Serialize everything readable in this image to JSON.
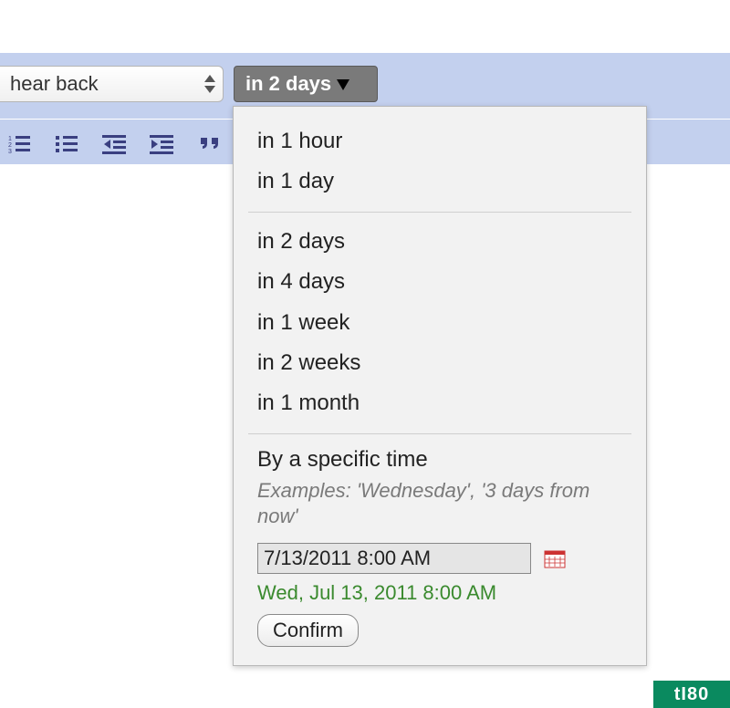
{
  "select": {
    "label": "hear back"
  },
  "time_button": {
    "label": "in 2 days"
  },
  "menu": {
    "group1": [
      "in 1 hour",
      "in 1 day"
    ],
    "group2": [
      "in 2 days",
      "in 4 days",
      "in 1 week",
      "in 2 weeks",
      "in 1 month"
    ],
    "specific": {
      "title": "By a specific time",
      "examples": "Examples: 'Wednesday', '3 days from now'",
      "input_value": "7/13/2011 8:00 AM",
      "parsed": "Wed, Jul 13, 2011 8:00 AM",
      "confirm": "Confirm"
    }
  },
  "watermark": "tI80"
}
